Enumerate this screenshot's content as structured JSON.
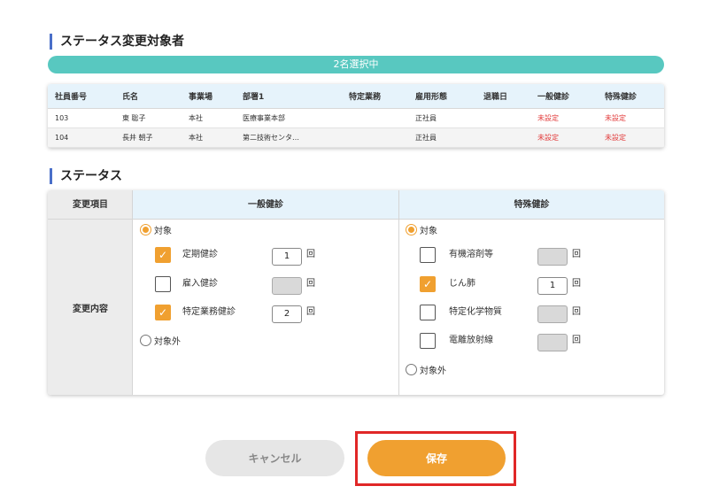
{
  "section1_title": "ステータス変更対象者",
  "selected_banner": "2名選択中",
  "employee_table": {
    "headers": [
      "社員番号",
      "氏名",
      "事業場",
      "部署1",
      "特定業務",
      "雇用形態",
      "退職日",
      "一般健診",
      "特殊健診"
    ],
    "rows": [
      [
        "103",
        "東 聡子",
        "本社",
        "医療事業本部",
        "",
        "正社員",
        "",
        "未設定",
        "未設定"
      ],
      [
        "104",
        "長井 朝子",
        "本社",
        "第二技術センタ…",
        "",
        "正社員",
        "",
        "未設定",
        "未設定"
      ]
    ]
  },
  "section2_title": "ステータス",
  "status_table": {
    "header_item": "変更項目",
    "header_general": "一般健診",
    "header_special": "特殊健診",
    "row_label": "変更内容",
    "general": {
      "target_label": "対象",
      "non_target_label": "対象外",
      "items": [
        {
          "label": "定期健診",
          "checked": true,
          "count": "1",
          "unit": "回"
        },
        {
          "label": "雇入健診",
          "checked": false,
          "count": "",
          "unit": "回"
        },
        {
          "label": "特定業務健診",
          "checked": true,
          "count": "2",
          "unit": "回"
        }
      ]
    },
    "special": {
      "target_label": "対象",
      "non_target_label": "対象外",
      "items": [
        {
          "label": "有機溶剤等",
          "checked": false,
          "count": "",
          "unit": "回"
        },
        {
          "label": "じん肺",
          "checked": true,
          "count": "1",
          "unit": "回"
        },
        {
          "label": "特定化学物質",
          "checked": false,
          "count": "",
          "unit": "回"
        },
        {
          "label": "電離放射線",
          "checked": false,
          "count": "",
          "unit": "回"
        }
      ]
    }
  },
  "buttons": {
    "cancel": "キャンセル",
    "save": "保存"
  },
  "colors": {
    "accent": "#f0a030",
    "teal": "#58c8c0",
    "highlight": "#e02727",
    "unset_red": "#e23b3b"
  }
}
